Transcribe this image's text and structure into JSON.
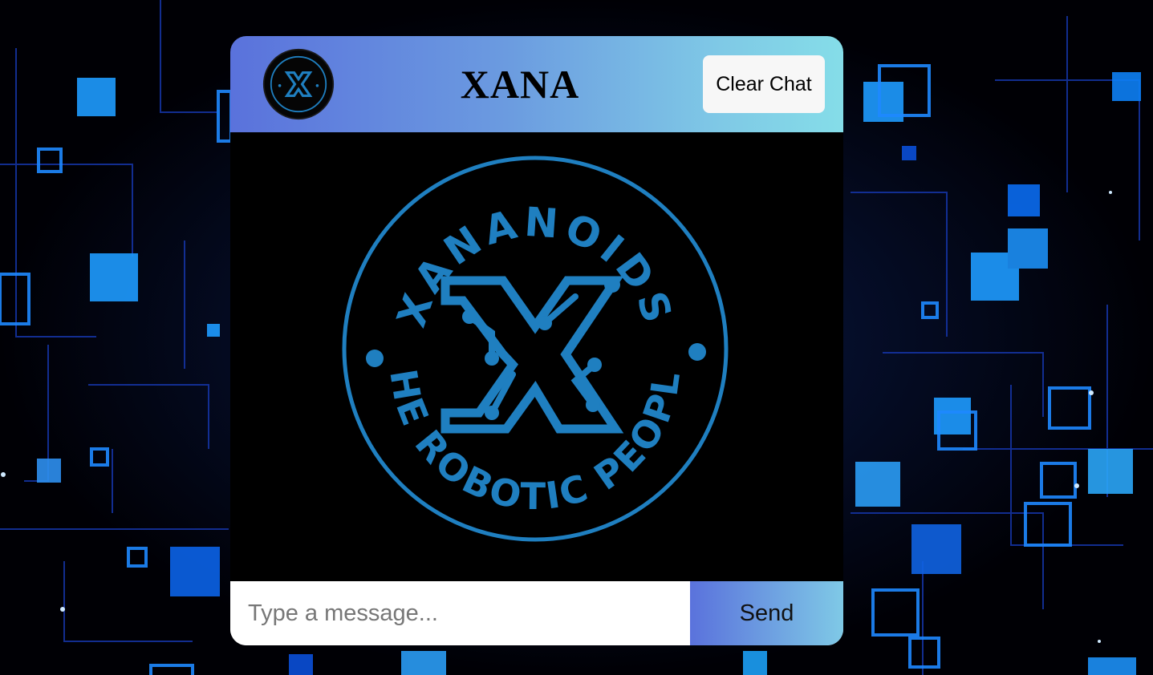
{
  "header": {
    "title": "XANA",
    "clear_button_label": "Clear Chat"
  },
  "logo": {
    "top_text": "XANANOIDS",
    "bottom_text": "THE ROBOTIC PEOPLE"
  },
  "input": {
    "placeholder": "Type a message...",
    "value": ""
  },
  "send_button_label": "Send",
  "colors": {
    "logo_blue": "#1f7fc0",
    "header_gradient_start": "#5a72dc",
    "header_gradient_end": "#85dde8",
    "background": "#000000"
  }
}
